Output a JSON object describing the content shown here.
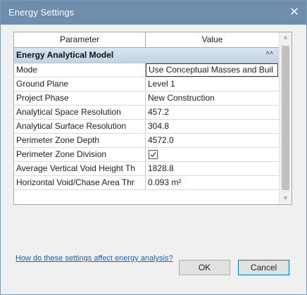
{
  "window": {
    "title": "Energy Settings",
    "close_glyph": "✕"
  },
  "grid": {
    "columns": [
      "Parameter",
      "Value"
    ],
    "group": {
      "label": "Energy Analytical Model",
      "collapse_glyph": "˄˄"
    },
    "rows": [
      {
        "param": "Mode",
        "value": "Use Conceptual Masses and Buil"
      },
      {
        "param": "Ground Plane",
        "value": "Level 1"
      },
      {
        "param": "Project Phase",
        "value": "New Construction"
      },
      {
        "param": "Analytical Space Resolution",
        "value": "457.2"
      },
      {
        "param": "Analytical Surface Resolution",
        "value": "304.8"
      },
      {
        "param": "Perimeter Zone Depth",
        "value": "4572.0"
      },
      {
        "param": "Perimeter Zone Division",
        "value": "",
        "checked": true
      },
      {
        "param": "Average Vertical Void Height Th",
        "value": "1828.8"
      },
      {
        "param": "Horizontal Void/Chase Area Thr",
        "value": "0.093 m²"
      }
    ],
    "scroll_up_glyph": "˄",
    "scroll_down_glyph": "˅"
  },
  "help_link": "How do these settings affect energy analysis?",
  "buttons": {
    "ok": "OK",
    "cancel": "Cancel"
  }
}
